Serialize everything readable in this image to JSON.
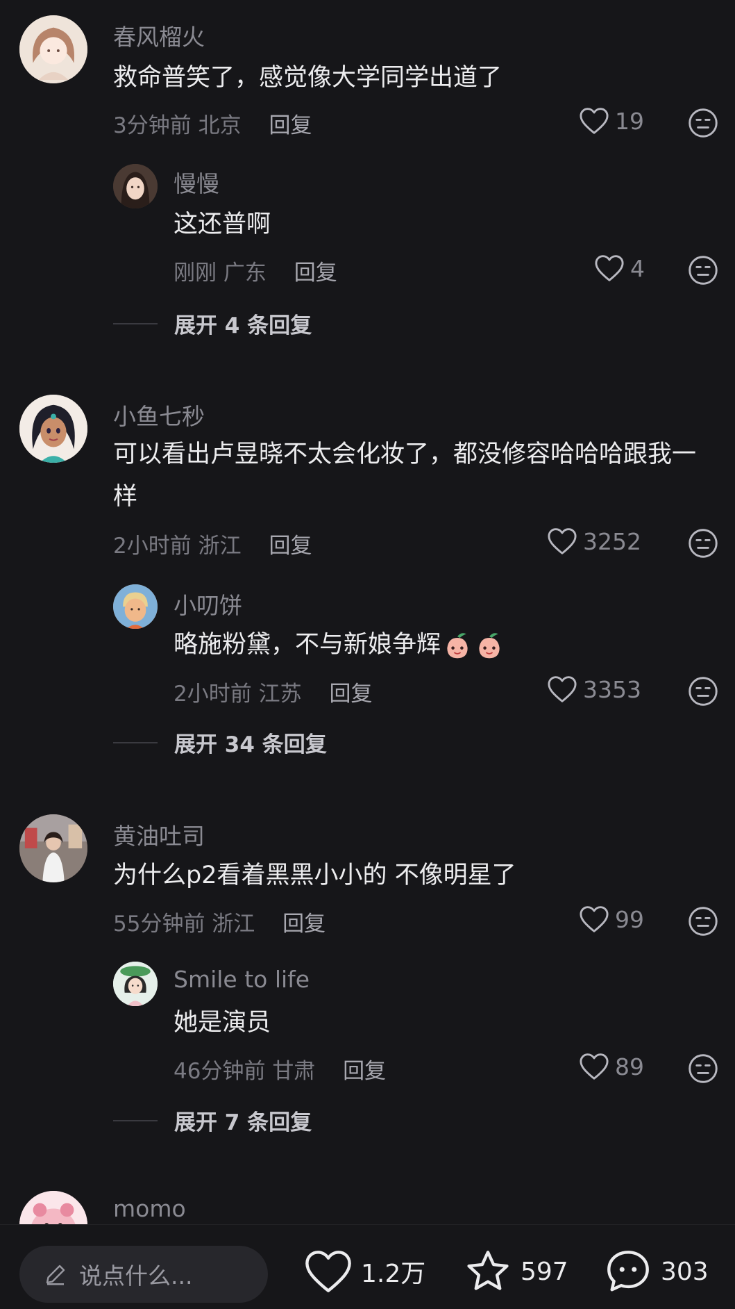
{
  "comments": [
    {
      "name": "春风榴火",
      "text": "救命普笑了，感觉像大学同学出道了",
      "time": "3分钟前",
      "location": "北京",
      "reply_label": "回复",
      "likes": "19",
      "avatar_icon": "avatar-girl-icon",
      "sub": {
        "name": "慢慢",
        "text": "这还普啊",
        "time": "刚刚",
        "location": "广东",
        "reply_label": "回复",
        "likes": "4",
        "avatar_icon": "avatar-woman-icon"
      },
      "expand": "展开 4 条回复"
    },
    {
      "name": "小鱼七秒",
      "text": "可以看出卢昱晓不太会化妆了，都没修容哈哈哈跟我一样",
      "time": "2小时前",
      "location": "浙江",
      "reply_label": "回复",
      "likes": "3252",
      "avatar_icon": "avatar-princess-icon",
      "sub": {
        "name": "小叨饼",
        "text": "略施粉黛，不与新娘争辉",
        "time": "2小时前",
        "location": "江苏",
        "reply_label": "回复",
        "likes": "3353",
        "avatar_icon": "avatar-child-icon",
        "emojis": [
          "peach-emoji-icon",
          "peach-emoji-icon"
        ]
      },
      "expand": "展开 34 条回复"
    },
    {
      "name": "黄油吐司",
      "text": "为什么p2看着黑黑小小的 不像明星了",
      "time": "55分钟前",
      "location": "浙江",
      "reply_label": "回复",
      "likes": "99",
      "avatar_icon": "avatar-photo-icon",
      "sub": {
        "name": "Smile to life",
        "text": "她是演员",
        "time": "46分钟前",
        "location": "甘肃",
        "reply_label": "回复",
        "likes": "89",
        "avatar_icon": "avatar-cartoon-icon"
      },
      "expand": "展开 7 条回复"
    },
    {
      "name": "momo",
      "avatar_icon": "avatar-pig-icon"
    }
  ],
  "bottom_bar": {
    "input_placeholder": "说点什么...",
    "likes": "1.2万",
    "favorites": "597",
    "comments": "303"
  },
  "colors": {
    "background": "#161619",
    "text": "#ececee",
    "muted": "#8a8a92"
  }
}
